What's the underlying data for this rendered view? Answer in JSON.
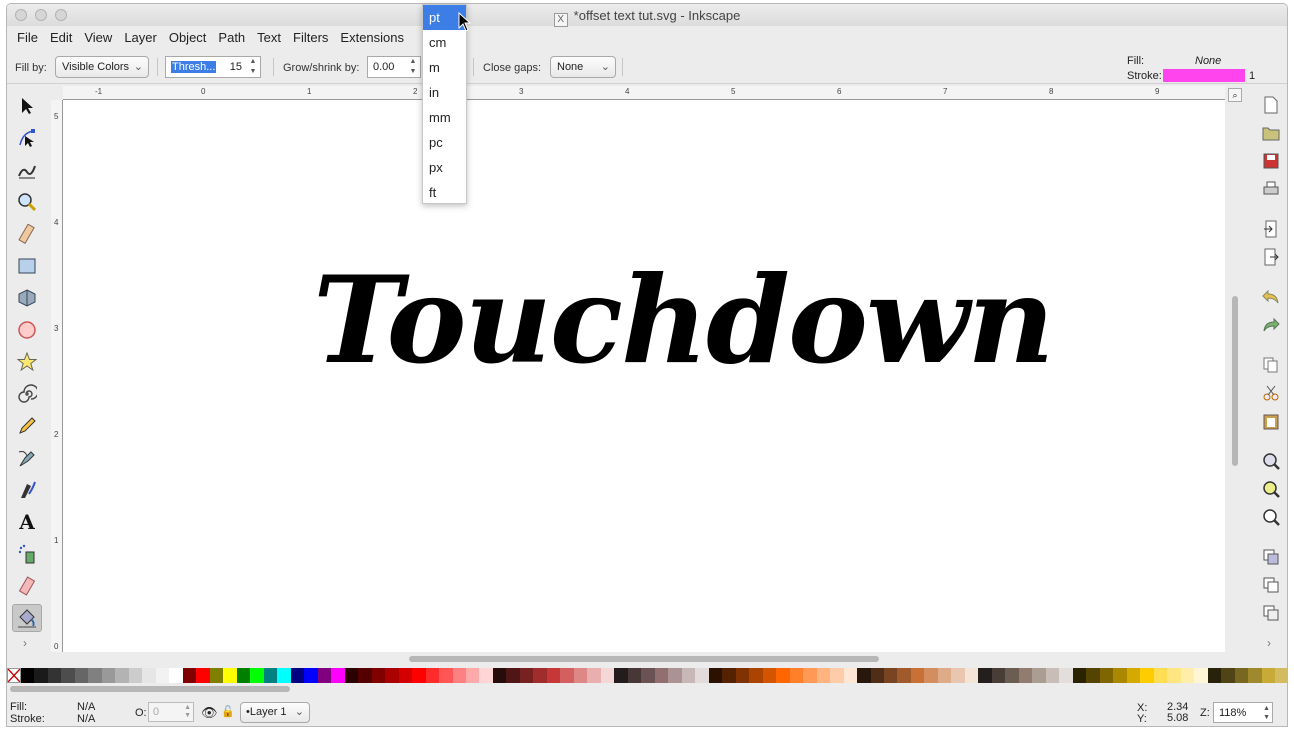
{
  "window": {
    "title": "*offset text tut.svg - Inkscape"
  },
  "menu": [
    "File",
    "Edit",
    "View",
    "Layer",
    "Object",
    "Path",
    "Text",
    "Filters",
    "Extensions"
  ],
  "toolcontrols": {
    "fill_by_label": "Fill by:",
    "fill_by_value": "Visible Colors",
    "threshold_label": "Thresh...",
    "threshold_value": "15",
    "grow_label": "Grow/shrink by:",
    "grow_value": "0.00",
    "close_gaps_label": "Close gaps:",
    "close_gaps_value": "None"
  },
  "fill_stroke": {
    "fill_label": "Fill:",
    "fill_value": "None",
    "stroke_label": "Stroke:",
    "stroke_width": "1",
    "stroke_color": "#ff44ee"
  },
  "unit_dropdown": {
    "options": [
      "pt",
      "cm",
      "m",
      "in",
      "mm",
      "pc",
      "px",
      "ft"
    ],
    "selected": "pt"
  },
  "canvas": {
    "text": "Touchdown"
  },
  "hruler_labels": [
    "-1",
    "0",
    "1",
    "2",
    "3",
    "4",
    "5",
    "6",
    "7",
    "8",
    "9"
  ],
  "vruler_labels": [
    "5",
    "4",
    "3",
    "2",
    "1",
    "0"
  ],
  "status": {
    "fill_label": "Fill:",
    "fill_value": "N/A",
    "stroke_label": "Stroke:",
    "stroke_value": "N/A",
    "opacity_label": "O:",
    "opacity_value": "0",
    "layer": "•Layer 1",
    "x_label": "X:",
    "x_value": "2.34",
    "y_label": "Y:",
    "y_value": "5.08",
    "zoom_label": "Z:",
    "zoom_value": "118%"
  },
  "colors": {
    "accent": "#3d7ee6",
    "stroke_swatch": "#ff44ee"
  },
  "palette": [
    "#000000",
    "#1a1a1a",
    "#333333",
    "#4d4d4d",
    "#666666",
    "#808080",
    "#999999",
    "#b3b3b3",
    "#cccccc",
    "#e6e6e6",
    "#f2f2f2",
    "#ffffff",
    "#800000",
    "#ff0000",
    "#808000",
    "#ffff00",
    "#008000",
    "#00ff00",
    "#008080",
    "#00ffff",
    "#000080",
    "#0000ff",
    "#800080",
    "#ff00ff",
    "#2b0000",
    "#550000",
    "#800000",
    "#aa0000",
    "#d40000",
    "#ff0000",
    "#ff2a2a",
    "#ff5555",
    "#ff8080",
    "#ffaaaa",
    "#ffd5d5",
    "#280b0b",
    "#501616",
    "#782121",
    "#a02c2c",
    "#c83737",
    "#d35f5f",
    "#de8787",
    "#e9afaf",
    "#f4d7d7",
    "#241c1c",
    "#483737",
    "#6c5353",
    "#916f6f",
    "#ac9393",
    "#c8b7b7",
    "#e3dbdb",
    "#2b1100",
    "#552200",
    "#803300",
    "#aa4400",
    "#d45500",
    "#ff6600",
    "#ff7f2a",
    "#ff9955",
    "#ffb380",
    "#ffccaa",
    "#ffe6d5",
    "#28170b",
    "#502d16",
    "#784421",
    "#a05a2c",
    "#c87137",
    "#d38d5f",
    "#deaa87",
    "#e9c6af",
    "#f4e3d7",
    "#241f1c",
    "#483e37",
    "#6c5d53",
    "#917c6f",
    "#ac9d93",
    "#c8beb7",
    "#e3dedb",
    "#2b2200",
    "#554400",
    "#806600",
    "#aa8800",
    "#d4aa00",
    "#ffcc00",
    "#ffdd55",
    "#ffe680",
    "#ffeeaa",
    "#fff6d5",
    "#28220b",
    "#504416",
    "#786721",
    "#a0892c",
    "#c8ab37",
    "#d3bc5f"
  ],
  "tools": [
    "selector-icon",
    "node-icon",
    "tweak-icon",
    "zoom-icon",
    "measure-icon",
    "rect-icon",
    "box3d-icon",
    "ellipse-icon",
    "star-icon",
    "spiral-icon",
    "pencil-icon",
    "pen-icon",
    "calligraphy-icon",
    "text-icon",
    "spray-icon",
    "eraser-icon",
    "paint-bucket-icon"
  ],
  "commands": [
    "new-doc-icon",
    "open-icon",
    "save-icon",
    "print-icon",
    "import-icon",
    "export-icon",
    "undo-icon",
    "redo-icon",
    "copy-icon",
    "cut-icon",
    "paste-icon",
    "zoom-selection-icon",
    "zoom-drawing-icon",
    "zoom-page-icon",
    "duplicate-icon",
    "clone-icon",
    "unlink-clone-icon"
  ]
}
